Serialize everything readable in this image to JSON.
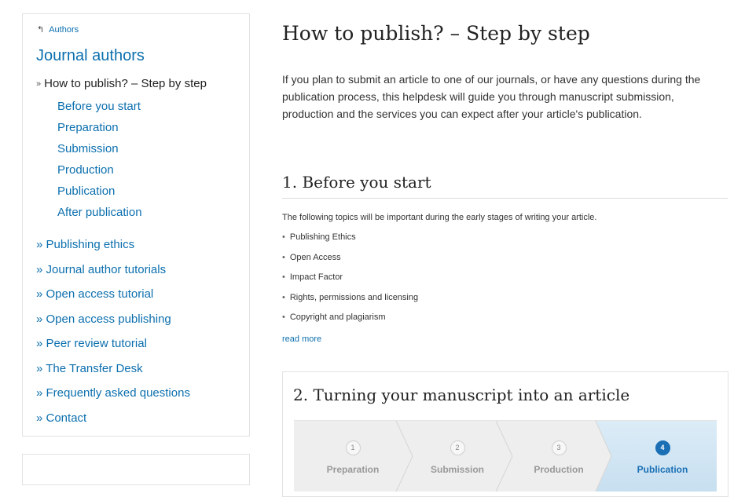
{
  "sidebar": {
    "back_link": "Authors",
    "title": "Journal authors",
    "current_item": "How to publish? – Step by step",
    "sub_items": [
      {
        "label": "Before you start"
      },
      {
        "label": "Preparation"
      },
      {
        "label": "Submission"
      },
      {
        "label": "Production"
      },
      {
        "label": "Publication"
      },
      {
        "label": "After publication"
      }
    ],
    "items": [
      {
        "label": "» Publishing ethics"
      },
      {
        "label": "» Journal author tutorials"
      },
      {
        "label": "» Open access tutorial"
      },
      {
        "label": "» Open access publishing"
      },
      {
        "label": "» Peer review tutorial"
      },
      {
        "label": "» The Transfer Desk"
      },
      {
        "label": "» Frequently asked questions"
      },
      {
        "label": "» Contact"
      }
    ]
  },
  "main": {
    "title": "How to publish? – Step by step",
    "intro": "If you plan to submit an article to one of our journals, or have any questions during the publication process, this helpdesk will guide you through manuscript submission, production and the services you can expect after your article's publication.",
    "section1": {
      "title": "1. Before you start",
      "lead": "The following topics will be important during the early stages of writing your article.",
      "topics": [
        {
          "label": "Publishing Ethics"
        },
        {
          "label": "Open Access"
        },
        {
          "label": "Impact Factor"
        },
        {
          "label": "Rights, permissions and licensing"
        },
        {
          "label": "Copyright and plagiarism"
        }
      ],
      "read_more": "read more"
    },
    "section2": {
      "title": "2. Turning your manuscript into an article",
      "steps": [
        {
          "num": "1",
          "label": "Preparation"
        },
        {
          "num": "2",
          "label": "Submission"
        },
        {
          "num": "3",
          "label": "Production"
        },
        {
          "num": "4",
          "label": "Publication"
        }
      ],
      "active_step": "Publication",
      "active_color": "#1a6fb5"
    }
  },
  "colors": {
    "link": "#0c6fae",
    "text": "#333333",
    "border": "#e2e2e2"
  },
  "icons": {
    "back": "back-arrow-icon",
    "expanded": "chevron-double-down-icon"
  }
}
